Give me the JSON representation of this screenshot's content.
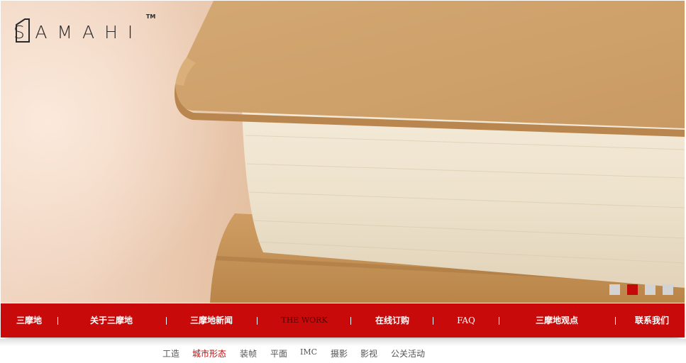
{
  "brand": {
    "logo_text_left": "SAMA",
    "logo_text_right": "HI",
    "trademark": "TM"
  },
  "slider": {
    "dots": [
      {
        "active": false
      },
      {
        "active": true
      },
      {
        "active": false
      },
      {
        "active": false
      }
    ]
  },
  "main_nav": {
    "items": [
      {
        "label": "三摩地"
      },
      {
        "label": "关于三摩地"
      },
      {
        "label": "三摩地新闻"
      },
      {
        "label": "THE WORK"
      },
      {
        "label": "在线订购"
      },
      {
        "label": "FAQ"
      },
      {
        "label": "三摩地观点"
      },
      {
        "label": "联系我们"
      }
    ],
    "current_index": 3
  },
  "sub_nav": {
    "items": [
      {
        "label": "工造"
      },
      {
        "label": "城市形态"
      },
      {
        "label": "装帧"
      },
      {
        "label": "平面"
      },
      {
        "label": "IMC"
      },
      {
        "label": "摄影"
      },
      {
        "label": "影视"
      },
      {
        "label": "公关活动"
      }
    ],
    "active_index": 1
  },
  "colors": {
    "nav_red": "#c80a0a",
    "dot_active": "#c30909",
    "dot_inactive": "#d3d3d3",
    "sub_nav_active": "#c30909"
  }
}
